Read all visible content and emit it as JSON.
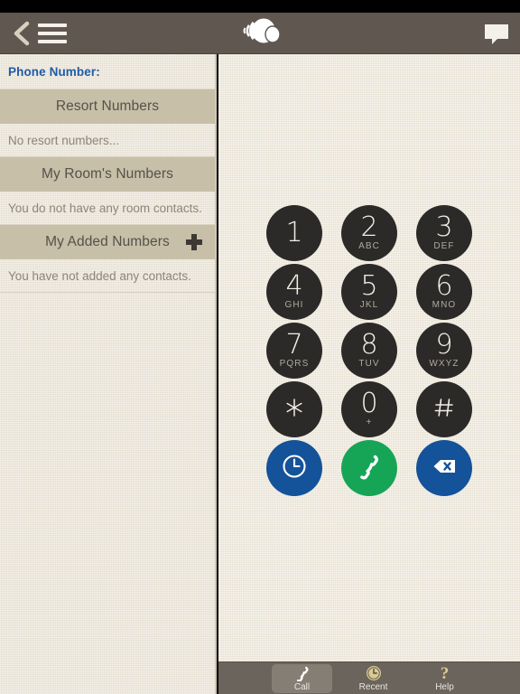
{
  "navbar": {
    "back_icon": "chevron-left-icon",
    "menu_icon": "hamburger-menu-icon",
    "logo_icon": "seashell-logo-icon",
    "chat_icon": "speech-bubble-icon"
  },
  "sidebar": {
    "phone_number_label": "Phone Number:",
    "sections": [
      {
        "title": "Resort Numbers",
        "has_add": false,
        "empty_text": "No resort numbers..."
      },
      {
        "title": "My Room's Numbers",
        "has_add": false,
        "empty_text": "You do not have any room contacts."
      },
      {
        "title": "My Added Numbers",
        "has_add": true,
        "add_icon": "plus-icon",
        "empty_text": "You have not added any contacts."
      }
    ]
  },
  "keypad": {
    "keys": [
      {
        "digit": "1",
        "letters": ""
      },
      {
        "digit": "2",
        "letters": "ABC"
      },
      {
        "digit": "3",
        "letters": "DEF"
      },
      {
        "digit": "4",
        "letters": "GHI"
      },
      {
        "digit": "5",
        "letters": "JKL"
      },
      {
        "digit": "6",
        "letters": "MNO"
      },
      {
        "digit": "7",
        "letters": "PQRS"
      },
      {
        "digit": "8",
        "letters": "TUV"
      },
      {
        "digit": "9",
        "letters": "WXYZ"
      },
      {
        "digit": "✳",
        "letters": ""
      },
      {
        "digit": "0",
        "letters": "+"
      },
      {
        "digit": "#",
        "letters": ""
      }
    ],
    "actions": [
      {
        "name": "recent-calls-button",
        "icon": "clock-icon",
        "color": "#14529a"
      },
      {
        "name": "call-button",
        "icon": "phone-handset-icon",
        "color": "#16a556"
      },
      {
        "name": "delete-button",
        "icon": "backspace-icon",
        "color": "#14529a"
      }
    ]
  },
  "tabbar": {
    "tabs": [
      {
        "label": "Call",
        "icon": "phone-handset-icon",
        "active": true
      },
      {
        "label": "Recent",
        "icon": "clock-icon",
        "active": false
      },
      {
        "label": "Help",
        "icon": "question-mark-icon",
        "active": false
      }
    ]
  },
  "colors": {
    "navbar": "#5f5750",
    "sidebar_bg": "#ece6d8",
    "section_header_bg": "#c7bfa8",
    "main_bg": "#efe9dc",
    "key_dark": "#2b2a28",
    "accent_blue": "#14529a",
    "accent_green": "#16a556",
    "link_blue": "#1f5ca8",
    "tabbar_bg": "#6b645c"
  }
}
